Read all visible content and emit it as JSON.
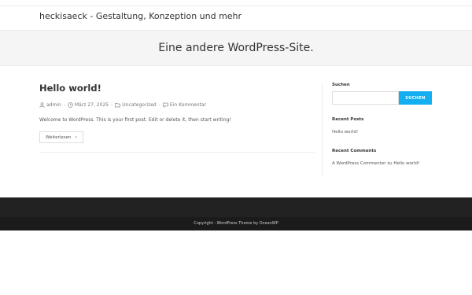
{
  "header": {
    "site_title": "heckisaeck - Gestaltung, Konzeption und mehr"
  },
  "hero": {
    "title": "Eine andere WordPress-Site."
  },
  "post": {
    "title": "Hello world!",
    "meta": {
      "author": "admin",
      "date": "März 27, 2025",
      "category": "Uncategorized",
      "comments": "Ein Kommentar"
    },
    "excerpt": "Welcome to WordPress. This is your first post. Edit or delete it, then start writing!",
    "read_more": "Weiterlesen"
  },
  "sidebar": {
    "search": {
      "title": "Suchen",
      "input_value": "",
      "button_label": "SUCHEN"
    },
    "recent_posts": {
      "title": "Recent Posts",
      "items": [
        "Hello world!"
      ]
    },
    "recent_comments": {
      "title": "Recent Comments",
      "author": "A WordPress Commenter",
      "connector": "zu",
      "post": "Hello world!"
    }
  },
  "footer": {
    "copyright": "Copyright - WordPress Theme by OceanWP"
  },
  "colors": {
    "accent": "#13aff0",
    "footer_bg": "#222222",
    "footer_bottom_bg": "#1b1b1b",
    "hero_bg": "#f5f5f5"
  },
  "icons": [
    "user-icon",
    "clock-icon",
    "folder-icon",
    "comment-icon",
    "chevron-right-icon"
  ]
}
